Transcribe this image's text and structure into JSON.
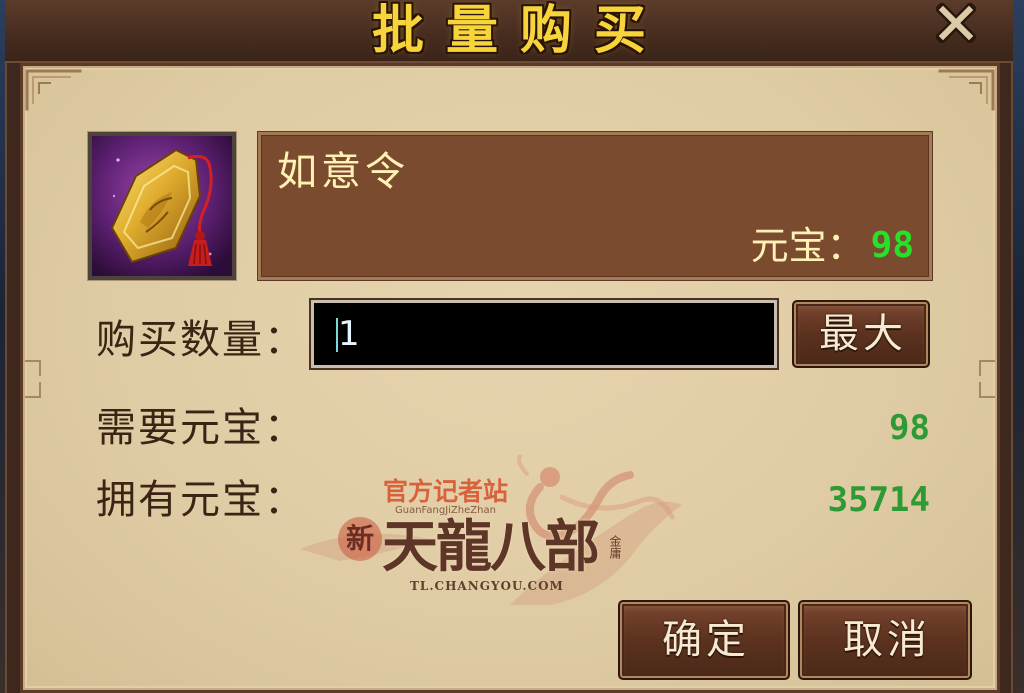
{
  "dialog": {
    "title": "批量购买"
  },
  "icons": {
    "close": "close-icon",
    "item": "ruyi-token-icon"
  },
  "item": {
    "name": "如意令",
    "price_label": "元宝：",
    "price_value": "98"
  },
  "quantity": {
    "label": "购买数量：",
    "value": "1",
    "max_label": "最大"
  },
  "cost": {
    "required_label": "需要元宝：",
    "required_value": "98",
    "owned_label": "拥有元宝：",
    "owned_value": "35714"
  },
  "watermark": {
    "site": "官方记者站",
    "site_pinyin": "GuanFangJiZheZhan",
    "prefix": "新",
    "title": "天龍八部",
    "seal": "金庸",
    "url": "TL.CHANGYOU.COM"
  },
  "actions": {
    "confirm": "确定",
    "cancel": "取消"
  },
  "colors": {
    "title": "#f6d43a",
    "label": "#3c2415",
    "value_green": "#2e9a33",
    "price_green": "#28e028",
    "item_name": "#fff2b4",
    "panel": "#dfcba3",
    "button_text": "#f7ead2"
  }
}
